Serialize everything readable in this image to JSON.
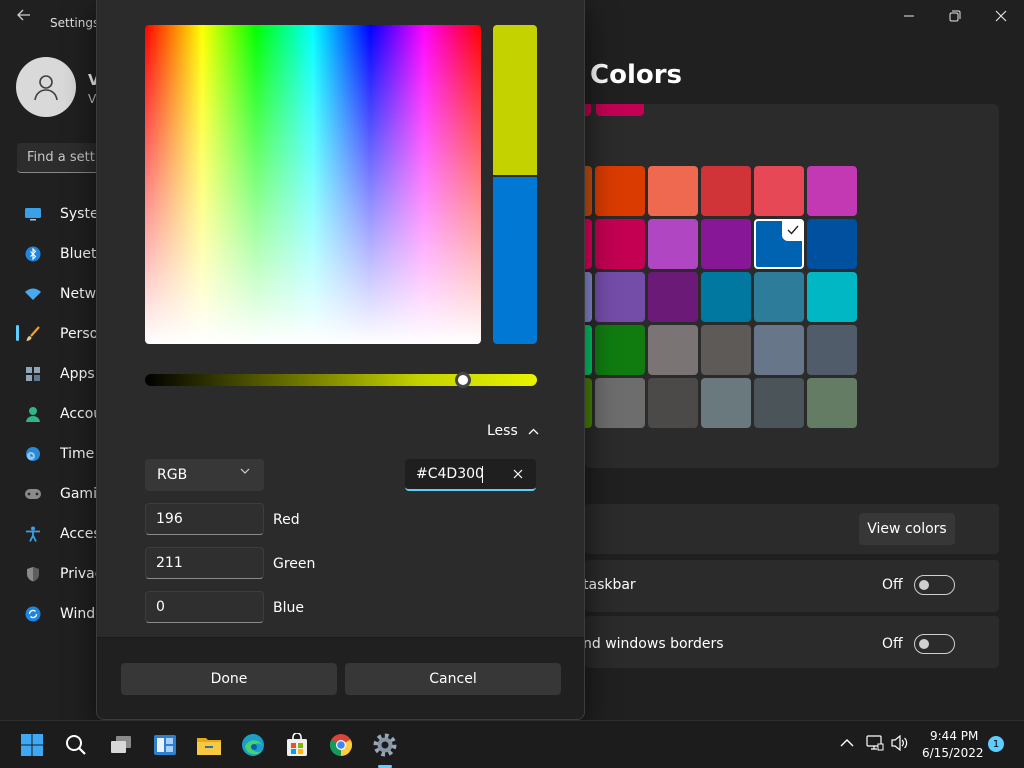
{
  "window": {
    "title": "Settings",
    "back_icon": "back-arrow-icon",
    "min_icon": "minimize-icon",
    "max_icon": "restore-icon",
    "close_icon": "close-icon"
  },
  "profile": {
    "name": "V",
    "sub": "V"
  },
  "search": {
    "placeholder": "Find a setting"
  },
  "sidebar": {
    "items": [
      {
        "label": "System",
        "icon": "monitor-icon"
      },
      {
        "label": "Bluetooth & devices",
        "icon": "bluetooth-icon"
      },
      {
        "label": "Network & internet",
        "icon": "wifi-icon"
      },
      {
        "label": "Personalization",
        "icon": "brush-icon",
        "selected": true
      },
      {
        "label": "Apps",
        "icon": "apps-icon"
      },
      {
        "label": "Accounts",
        "icon": "person-icon"
      },
      {
        "label": "Time & language",
        "icon": "clock-globe-icon"
      },
      {
        "label": "Gaming",
        "icon": "gamepad-icon"
      },
      {
        "label": "Accessibility",
        "icon": "accessibility-icon"
      },
      {
        "label": "Privacy & security",
        "icon": "shield-icon"
      },
      {
        "label": "Windows Update",
        "icon": "update-icon"
      }
    ]
  },
  "main": {
    "page_title": "Colors",
    "recent_color": "#c30052",
    "accent_swatches": [
      [
        "#ca5010",
        "#da3b01",
        "#ef6950",
        "#d13438",
        "#e74856",
        "#c239b3"
      ],
      [
        "#ea005e",
        "#c30052",
        "#b146c2",
        "#881798",
        "#0063b1",
        "#0050a0"
      ],
      [
        "#8e8cd8",
        "#744da9",
        "#6b1a78",
        "#0078a0",
        "#2d7d9a",
        "#00b7c3"
      ],
      [
        "#00cc6a",
        "#107c10",
        "#7a7574",
        "#5d5a58",
        "#68768a",
        "#515c6b"
      ],
      [
        "#498205",
        "#6d6d6d",
        "#4c4a48",
        "#69797e",
        "#4a5459",
        "#647c64"
      ]
    ],
    "selected_swatch": [
      1,
      4
    ],
    "view_colors_label": "View colors",
    "toggles": [
      {
        "label": "Show accent color on Start and taskbar",
        "visible_label": "taskbar",
        "state": "Off"
      },
      {
        "label": "Show accent color on title bars and windows borders",
        "visible_label": "nd windows borders",
        "state": "Off"
      }
    ]
  },
  "dialog": {
    "new_color": "#c4d300",
    "old_color": "#0078d4",
    "value_fraction": 0.81,
    "less_label": "Less",
    "mode": "RGB",
    "hex": "#C4D300",
    "channels": [
      {
        "label": "Red",
        "value": "196"
      },
      {
        "label": "Green",
        "value": "211"
      },
      {
        "label": "Blue",
        "value": "0"
      }
    ],
    "done_label": "Done",
    "cancel_label": "Cancel"
  },
  "taskbar": {
    "apps": [
      "start-icon",
      "search-icon",
      "task-view-icon",
      "widgets-icon",
      "file-explorer-icon",
      "edge-icon",
      "store-icon",
      "chrome-icon",
      "settings-gear-icon"
    ],
    "time": "9:44 PM",
    "date": "6/15/2022",
    "notification_count": "1"
  }
}
